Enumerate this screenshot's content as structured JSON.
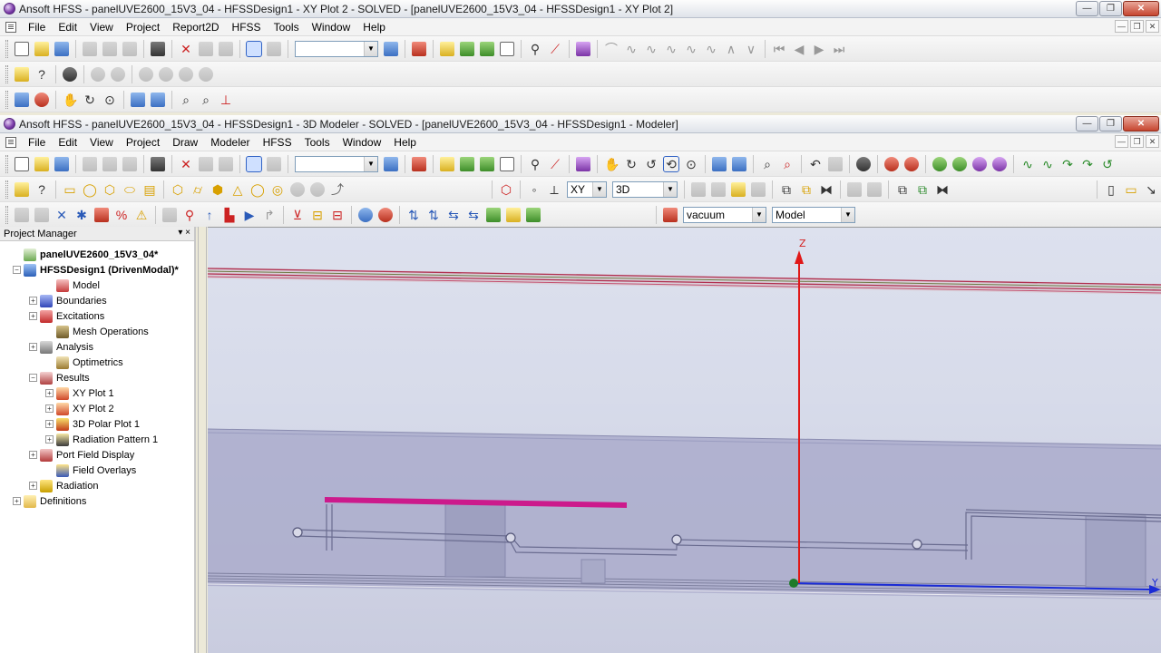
{
  "outer": {
    "title": "Ansoft HFSS - panelUVE2600_15V3_04 - HFSSDesign1 - XY Plot 2 - SOLVED - [panelUVE2600_15V3_04 - HFSSDesign1 - XY Plot 2]",
    "menu": [
      "File",
      "Edit",
      "View",
      "Project",
      "Report2D",
      "HFSS",
      "Tools",
      "Window",
      "Help"
    ]
  },
  "inner": {
    "title": "Ansoft HFSS - panelUVE2600_15V3_04 - HFSSDesign1 - 3D Modeler - SOLVED - [panelUVE2600_15V3_04 - HFSSDesign1 - Modeler]",
    "menu": [
      "File",
      "Edit",
      "View",
      "Project",
      "Draw",
      "Modeler",
      "HFSS",
      "Tools",
      "Window",
      "Help"
    ]
  },
  "toolbar": {
    "plane_value": "XY",
    "view_value": "3D",
    "material_value": "vacuum",
    "model_value": "Model",
    "empty_combo_value": ""
  },
  "window_buttons": {
    "minimize": "—",
    "restore": "❐",
    "close": "✕"
  },
  "project_manager": {
    "title": "Project Manager",
    "controls": "▾ ×",
    "tree": [
      {
        "label": "panelUVE2600_15V3_04*",
        "level": 0,
        "expander": "",
        "icon": "project-icon",
        "bold": true
      },
      {
        "label": "HFSSDesign1 (DrivenModal)*",
        "level": 0,
        "expander": "−",
        "icon": "design-icon",
        "bold": true
      },
      {
        "label": "Model",
        "level": 2,
        "expander": "",
        "icon": "model-icon"
      },
      {
        "label": "Boundaries",
        "level": 1,
        "expander": "+",
        "icon": "boundaries-icon"
      },
      {
        "label": "Excitations",
        "level": 1,
        "expander": "+",
        "icon": "excitations-icon"
      },
      {
        "label": "Mesh Operations",
        "level": 2,
        "expander": "",
        "icon": "mesh-icon"
      },
      {
        "label": "Analysis",
        "level": 1,
        "expander": "+",
        "icon": "analysis-icon"
      },
      {
        "label": "Optimetrics",
        "level": 2,
        "expander": "",
        "icon": "optimetrics-icon"
      },
      {
        "label": "Results",
        "level": 1,
        "expander": "−",
        "icon": "results-icon"
      },
      {
        "label": "XY Plot 1",
        "level": 2,
        "expander": "+",
        "icon": "xy-plot-icon"
      },
      {
        "label": "XY Plot 2",
        "level": 2,
        "expander": "+",
        "icon": "xy-plot-icon"
      },
      {
        "label": "3D Polar Plot 1",
        "level": 2,
        "expander": "+",
        "icon": "polar-plot-icon"
      },
      {
        "label": "Radiation Pattern 1",
        "level": 2,
        "expander": "+",
        "icon": "radiation-pattern-icon"
      },
      {
        "label": "Port Field Display",
        "level": 1,
        "expander": "+",
        "icon": "port-field-icon"
      },
      {
        "label": "Field Overlays",
        "level": 2,
        "expander": "",
        "icon": "field-overlays-icon"
      },
      {
        "label": "Radiation",
        "level": 1,
        "expander": "+",
        "icon": "radiation-icon"
      },
      {
        "label": "Definitions",
        "level": 0,
        "expander": "+",
        "icon": "folder-icon"
      }
    ]
  },
  "viewport": {
    "z_axis_label": "Z",
    "y_axis_label": "Y",
    "colors": {
      "z_axis": "#e01818",
      "y_axis": "#1a2bd6",
      "origin": "#1e7a2a",
      "strip": "#cc1a8c",
      "ground_stripes": "#b03050",
      "substrate": "#aaaccb"
    }
  }
}
